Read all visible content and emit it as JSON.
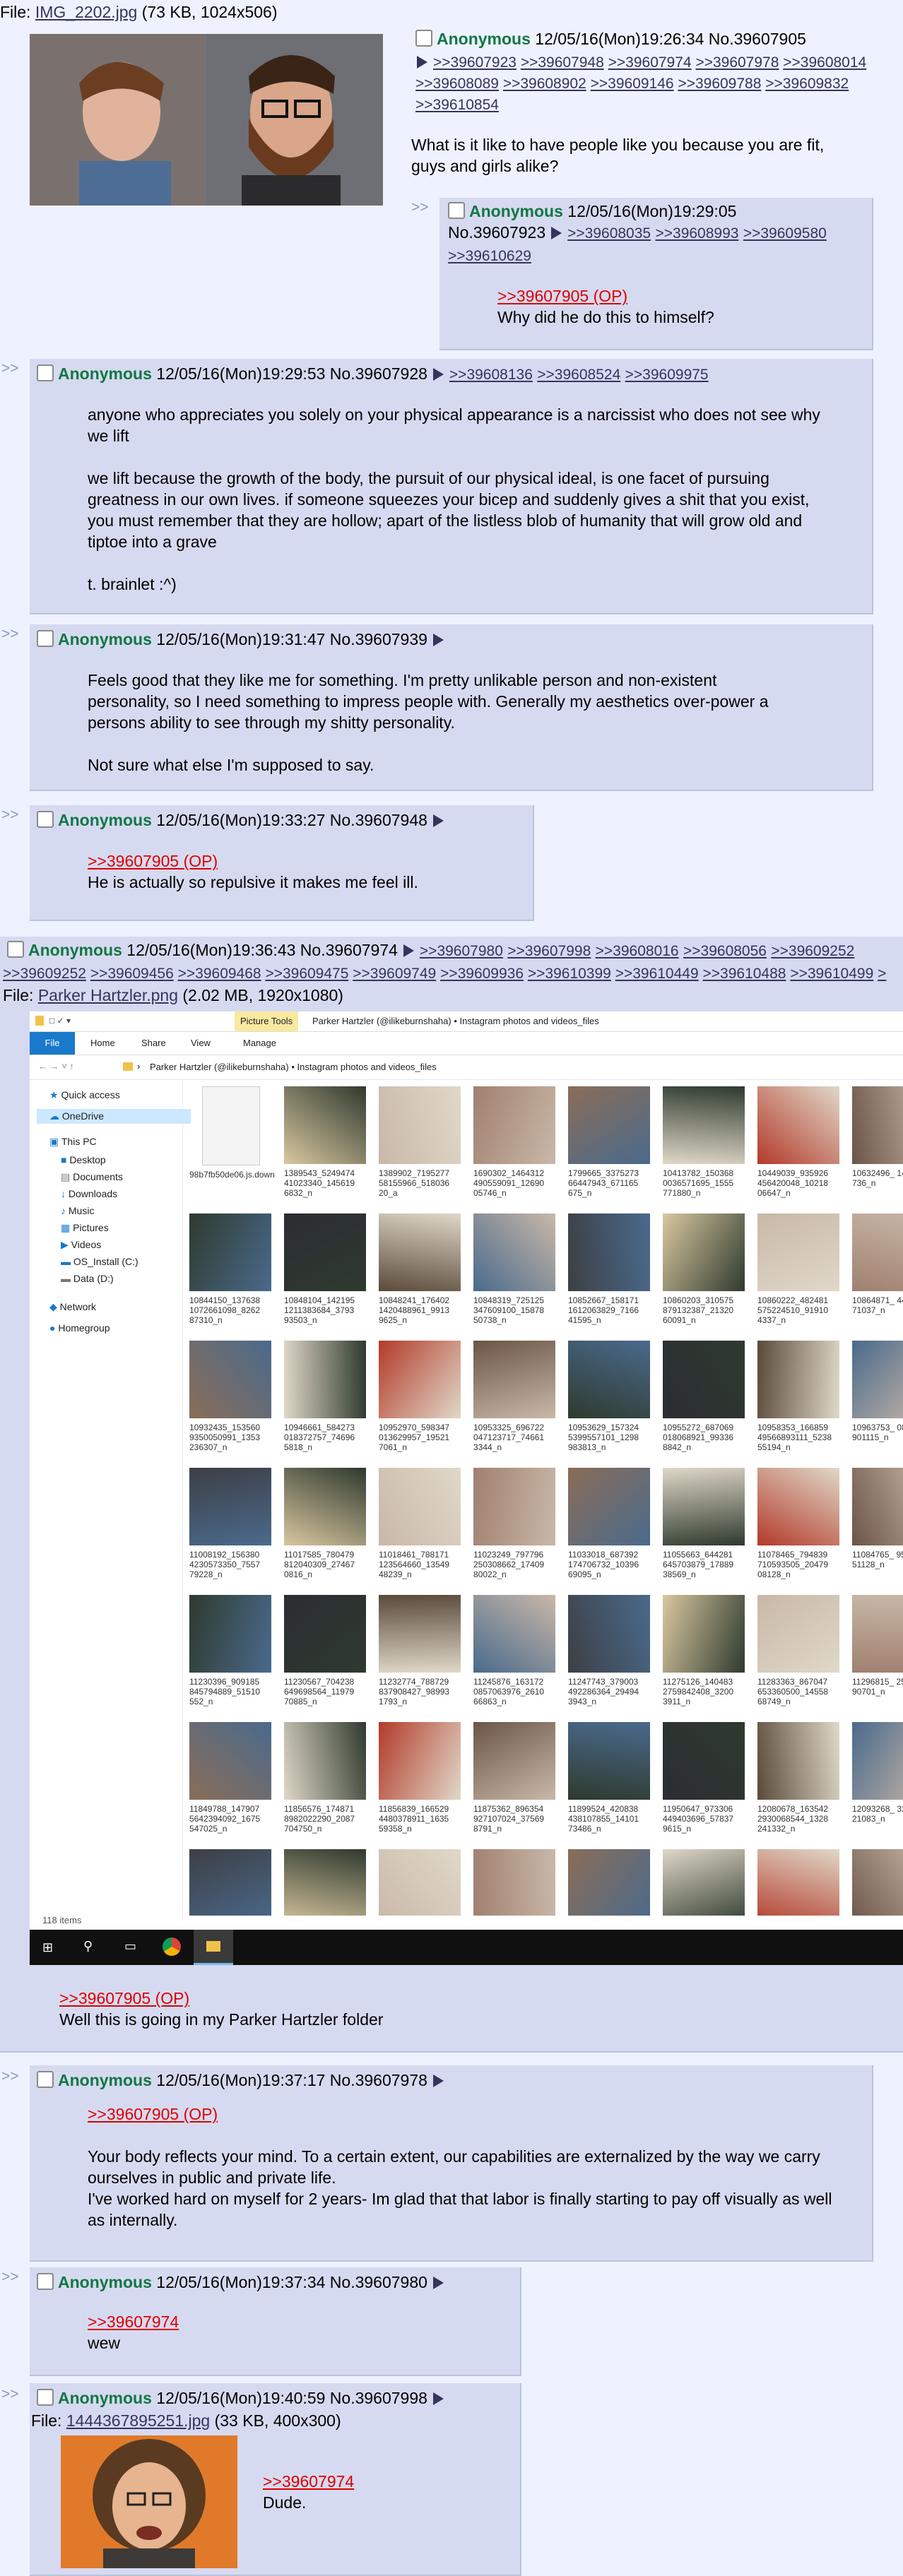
{
  "op": {
    "file_label": "File: ",
    "file_name": "IMG_2202.jpg",
    "file_meta": " (73 KB, 1024x506)",
    "name": "Anonymous",
    "datetime": "12/05/16(Mon)19:26:34",
    "no": "No.39607905",
    "backlinks": [
      ">>39607923",
      ">>39607948",
      ">>39607974",
      ">>39607978",
      ">>39608014",
      ">>39608089",
      ">>39608902",
      ">>39609146",
      ">>39609788",
      ">>39609832",
      ">>39610854"
    ],
    "body": "What is it like to have people like you because you are fit, guys and girls alike?"
  },
  "posts": [
    {
      "name": "Anonymous",
      "datetime": "12/05/16(Mon)19:29:05",
      "no": "No.39607923",
      "backlinks": [
        ">>39608035",
        ">>39608993",
        ">>39609580",
        ">>39610629"
      ],
      "quote": ">>39607905 (OP)",
      "body": "Why did he do this to himself?"
    },
    {
      "name": "Anonymous",
      "datetime": "12/05/16(Mon)19:29:53",
      "no": "No.39607928",
      "backlinks": [
        ">>39608136",
        ">>39608524",
        ">>39609975"
      ],
      "p1": "anyone who appreciates you solely on your physical appearance is a narcissist who does not see why we lift",
      "p2": "we lift because the growth of the body, the pursuit of our physical ideal, is one facet of pursuing greatness in our own lives. if someone squeezes your bicep and suddenly gives a shit that you exist, you must remember that they are hollow; apart of the listless blob of humanity that will grow old and tiptoe into a grave",
      "p3": "t. brainlet :^)"
    },
    {
      "name": "Anonymous",
      "datetime": "12/05/16(Mon)19:31:47",
      "no": "No.39607939",
      "p1": "Feels good that they like me for something. I'm pretty unlikable person and non-existent personality, so I need something to impress people with. Generally my aesthetics over-power a persons ability to see through my shitty personality.",
      "p2": "Not sure what else I'm supposed to say."
    },
    {
      "name": "Anonymous",
      "datetime": "12/05/16(Mon)19:33:27",
      "no": "No.39607948",
      "quote": ">>39607905 (OP)",
      "body": "He is actually so repulsive it makes me feel ill."
    },
    {
      "name": "Anonymous",
      "datetime": "12/05/16(Mon)19:36:43",
      "no": "No.39607974",
      "backlinks": [
        ">>39607980",
        ">>39607998",
        ">>39608016",
        ">>39608056",
        ">>39609252",
        ">>39609456",
        ">>39609468",
        ">>39609475",
        ">>39609749",
        ">>39609936",
        ">>39610399",
        ">>39610449",
        ">>39610488",
        ">>39610499",
        ">"
      ],
      "file_label": "File: ",
      "file_name": "Parker Hartzler.png",
      "file_meta": " (2.02 MB, 1920x1080)",
      "quote": ">>39607905 (OP)",
      "body": "Well this is going in my Parker Hartzler folder"
    },
    {
      "name": "Anonymous",
      "datetime": "12/05/16(Mon)19:37:17",
      "no": "No.39607978",
      "quote": ">>39607905 (OP)",
      "p1": "Your body reflects your mind. To a certain extent, our capabilities are externalized by the way we carry ourselves in public and private life.",
      "p2": "I've worked hard on myself for 2 years- Im glad that that labor is finally starting to pay off visually as well as internally."
    },
    {
      "name": "Anonymous",
      "datetime": "12/05/16(Mon)19:37:34",
      "no": "No.39607980",
      "quote": ">>39607974",
      "body": "wew"
    },
    {
      "name": "Anonymous",
      "datetime": "12/05/16(Mon)19:40:59",
      "no": "No.39607998",
      "file_label": "File: ",
      "file_name": "1444367895251.jpg",
      "file_meta": " (33 KB, 400x300)",
      "quote": ">>39607974",
      "body": "Dude."
    }
  ],
  "explorer": {
    "ribbon_tabs": [
      "File",
      "Home",
      "Share",
      "View",
      "Manage"
    ],
    "picture_tools": "Picture Tools",
    "window_title": "Parker Hartzler (@ilikeburnshaha) • Instagram photos and videos_files",
    "address": "Parker Hartzler (@ilikeburnshaha) • Instagram photos and videos_files",
    "nav": [
      "Quick access",
      "OneDrive",
      "This PC",
      "Desktop",
      "Documents",
      "Downloads",
      "Music",
      "Pictures",
      "Videos",
      "OS_Install (C:)",
      "Data (D:)",
      "Network",
      "Homegroup"
    ],
    "status": "118 items",
    "files": [
      "98b7fb50de06.js.download",
      "1389543_5249474 41023340_145619 6832_n",
      "1389902_7195277 58155966_518036 20_a",
      "1690302_1464312 490559091_12690 05746_n",
      "1799665_3375273 66447943_671165 675_n",
      "10413782_150368 0036571695_1555 771880_n",
      "10449039_935926 456420048_10218 06647_n",
      "10632496_ 14767954 736_n",
      "10844150_137638 1072661098_8262 87310_n",
      "10848104_142195 1211383684_3793 93503_n",
      "10848241_176402 1420488961_9913 9625_n",
      "10848319_725125 347609100_15878 50738_n",
      "10852667_158171 1612063829_7166 41595_n",
      "10860203_310575 879132387_21320 60091_n",
      "10860222_482481 575224510_91910 4337_n",
      "10864871_ 44690251 71037_n",
      "10932435_153560 9350050991_1353 236307_n",
      "10946661_584273 018372757_74696 5818_n",
      "10952970_598347 013629957_19521 7061_n",
      "10953325_696722 047123717_74661 3344_n",
      "10953629_157324 5399557101_1298 983813_n",
      "10955272_687069 018068921_99336 8842_n",
      "10958353_166859 49566893111_5238 55194_n",
      "10963753_ 08382880 901115_n",
      "11008192_156380 4230573350_7557 79228_n",
      "11017585_780479 812040309_27467 0816_n",
      "11018461_788171 123564660_13549 48239_n",
      "11023249_797796 250308662_17409 80022_n",
      "11033018_687392 174706732_10396 69095_n",
      "11055663_644281 645703879_17889 38569_n",
      "11078465_794839 710593505_20479 08128_n",
      "11084765_ 95073996 51128_n",
      "11230396_909185 845794889_51510 552_n",
      "11230567_704238 649698564_11979 70885_n",
      "11232774_788729 837908427_98993 1793_n",
      "11245876_163172 0857063976_2610 66863_n",
      "11247743_379003 492286364_29494 3943_n",
      "11275126_140483 2759842408_3200 3911_n",
      "11283363_867047 653360500_14558 68749_n",
      "11296815_ 25957624 90701_n",
      "11849788_147907 5642394092_1675 547025_n",
      "11856576_174871 8982022290_2087 704750_n",
      "11856839_166529 4480378911_1635 59358_n",
      "11875362_896354 927107024_37569 8791_n",
      "11899524_420838 438107855_14101 73486_n",
      "11950647_973306 449403696_57837 9615_n",
      "12080678_163542 2930068544_1328 241332_n",
      "12093268_ 32780601 21083_n",
      "",
      "",
      "",
      "",
      "",
      "",
      "",
      ""
    ]
  },
  "colors": {
    "post_bg": "#d6daf0",
    "page_bg": "#eef2ff",
    "name": "#117743",
    "quote": "#dd0000",
    "link": "#34345c"
  }
}
